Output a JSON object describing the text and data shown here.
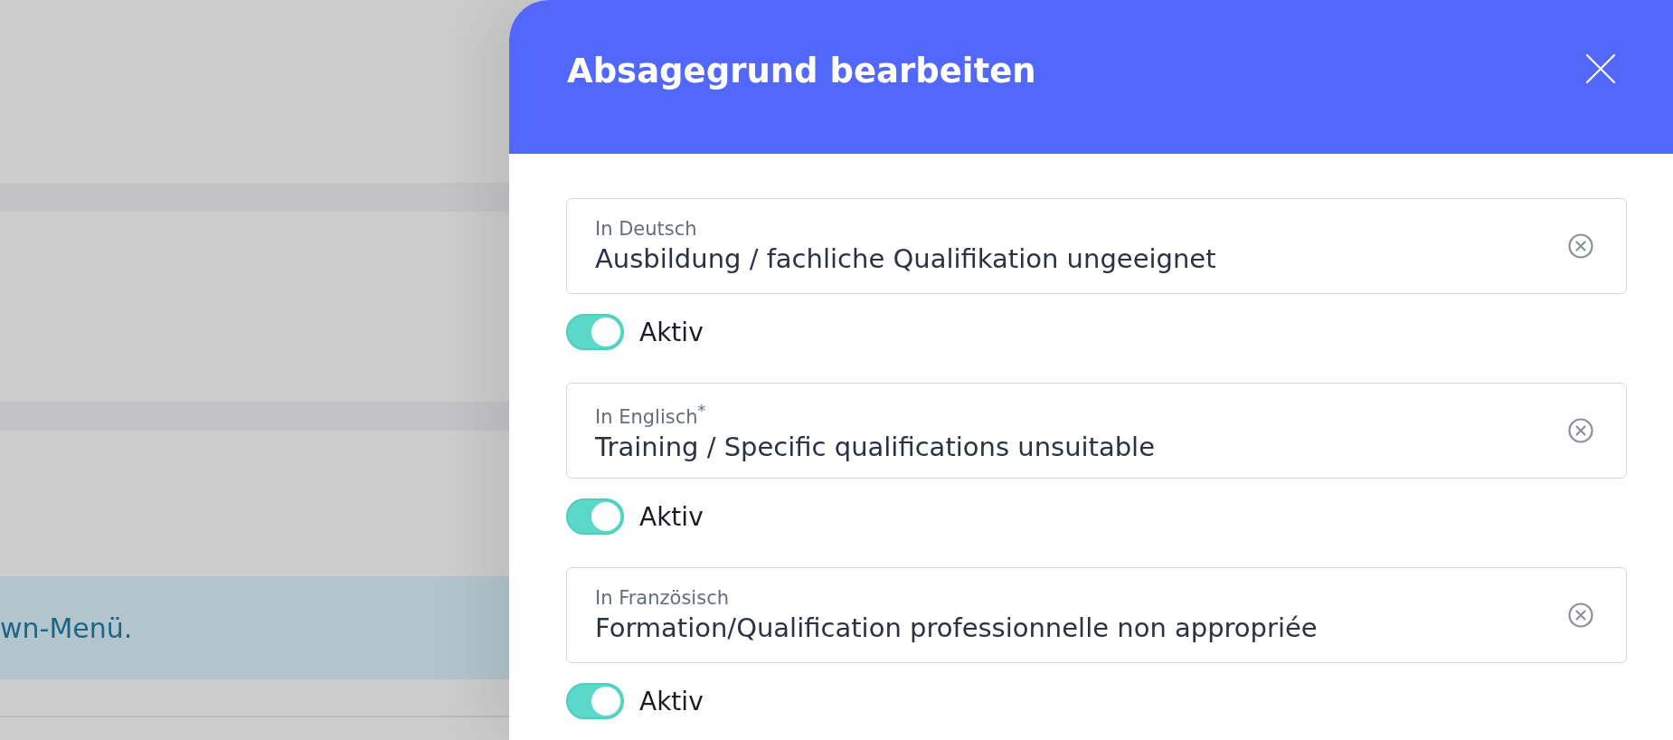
{
  "background": {
    "info_banner": "wn-Menü."
  },
  "drawer": {
    "title": "Absagegrund bearbeiten",
    "fields": [
      {
        "label": "In Deutsch",
        "value": "Ausbildung / fachliche Qualifikation ungeeignet",
        "active": {
          "label": "Aktiv",
          "on": true
        }
      },
      {
        "label": "In Englisch$^{*}$",
        "value": "Training / Specific qualifications unsuitable",
        "active": {
          "label": "Aktiv",
          "on": true
        }
      },
      {
        "label": "In Französisch",
        "value": "Formation/Qualification professionnelle non appropriée",
        "active": {
          "label": "Aktiv",
          "on": true
        }
      }
    ]
  }
}
